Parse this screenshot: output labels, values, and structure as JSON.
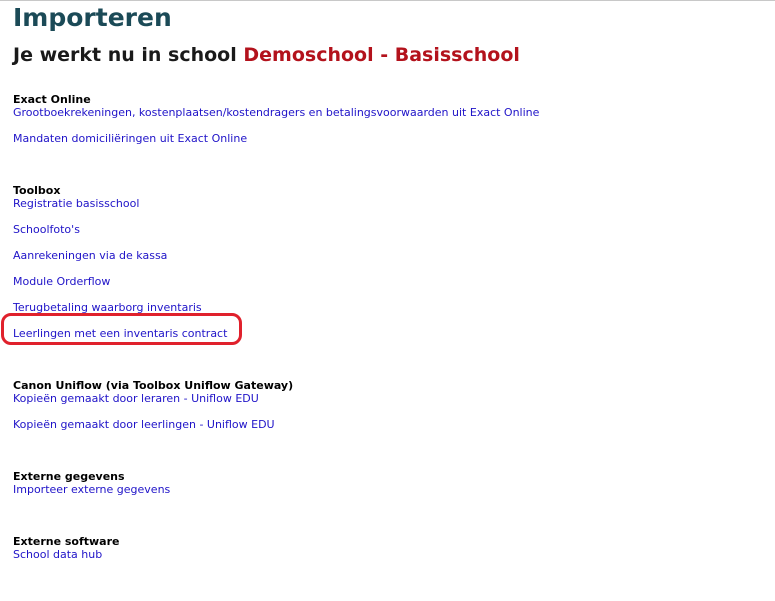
{
  "page": {
    "title": "Importeren",
    "school_prefix": "Je werkt nu in school",
    "school_name": "Demoschool - Basisschool"
  },
  "sections": {
    "exact_online": {
      "heading": "Exact Online",
      "links": [
        "Grootboekrekeningen, kostenplaatsen/kostendragers en betalingsvoorwaarden uit Exact Online",
        "Mandaten domiciliëringen uit Exact Online"
      ]
    },
    "toolbox": {
      "heading": "Toolbox",
      "links": [
        "Registratie basisschool",
        "Schoolfoto's",
        "Aanrekeningen via de kassa",
        "Module Orderflow",
        "Terugbetaling waarborg inventaris",
        "Leerlingen met een inventaris contract"
      ]
    },
    "canon_uniflow": {
      "heading": "Canon Uniflow (via Toolbox Uniflow Gateway)",
      "links": [
        "Kopieën gemaakt door leraren - Uniflow EDU",
        "Kopieën gemaakt door leerlingen - Uniflow EDU"
      ]
    },
    "externe_gegevens": {
      "heading": "Externe gegevens",
      "links": [
        "Importeer externe gegevens"
      ]
    },
    "externe_software": {
      "heading": "Externe software",
      "links": [
        "School data hub"
      ]
    }
  },
  "colors": {
    "title": "#1b4a57",
    "school_name": "#b3121c",
    "link": "#1f13c8",
    "highlight": "#e0212c"
  }
}
